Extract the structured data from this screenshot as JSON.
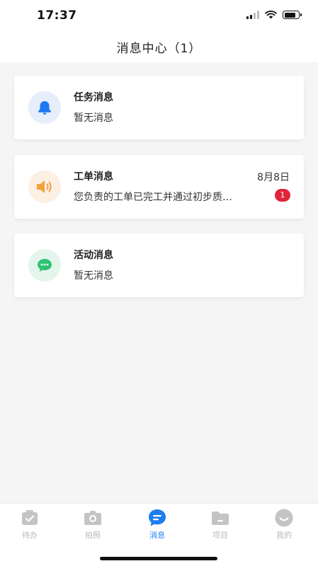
{
  "status_bar": {
    "time": "17:37",
    "battery_level": 0.85,
    "icons": [
      "signal-icon",
      "wifi-icon",
      "battery-icon"
    ]
  },
  "header": {
    "title": "消息中心（1）"
  },
  "messages": [
    {
      "title": "任务消息",
      "subtitle": "暂无消息",
      "date": "",
      "badge": "",
      "icon": "bell-icon",
      "icon_color": "#1e78f0",
      "icon_bg": "#e6eefb"
    },
    {
      "title": "工单消息",
      "subtitle": "您负责的工单已完工并通过初步质…",
      "date": "8月8日",
      "badge": "1",
      "icon": "speaker-icon",
      "icon_color": "#f5a03c",
      "icon_bg": "#fcefe4"
    },
    {
      "title": "活动消息",
      "subtitle": "暂无消息",
      "date": "",
      "badge": "",
      "icon": "chat-bubble-icon",
      "icon_color": "#2fc275",
      "icon_bg": "#e4f6ec"
    }
  ],
  "tabbar": {
    "active_color": "#1e7ef0",
    "inactive_color": "#c4c4c4",
    "items": [
      {
        "label": "待办",
        "icon": "todo-check-icon",
        "active": false
      },
      {
        "label": "拍照",
        "icon": "camera-icon",
        "active": false
      },
      {
        "label": "消息",
        "icon": "message-icon",
        "active": true
      },
      {
        "label": "项目",
        "icon": "folder-icon",
        "active": false
      },
      {
        "label": "我的",
        "icon": "profile-icon",
        "active": false
      }
    ]
  }
}
